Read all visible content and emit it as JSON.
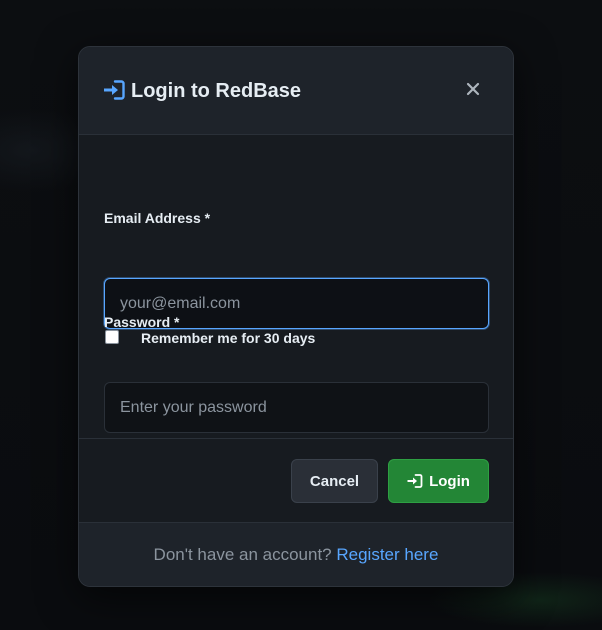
{
  "modal": {
    "title": "Login to RedBase",
    "title_icon": "sign-in-icon",
    "close_icon": "close-icon"
  },
  "form": {
    "email": {
      "label": "Email Address *",
      "placeholder": "your@email.com",
      "value": ""
    },
    "password": {
      "label": "Password *",
      "placeholder": "Enter your password",
      "value": ""
    },
    "remember": {
      "label": "Remember me for 30 days",
      "checked": false
    }
  },
  "actions": {
    "cancel_label": "Cancel",
    "login_label": "Login",
    "login_icon": "sign-in-icon"
  },
  "footer": {
    "prompt": "Don't have an account?",
    "register_link": "Register here"
  },
  "colors": {
    "accent": "#58a6ff",
    "primary_button": "#238636",
    "background": "#171b20"
  }
}
